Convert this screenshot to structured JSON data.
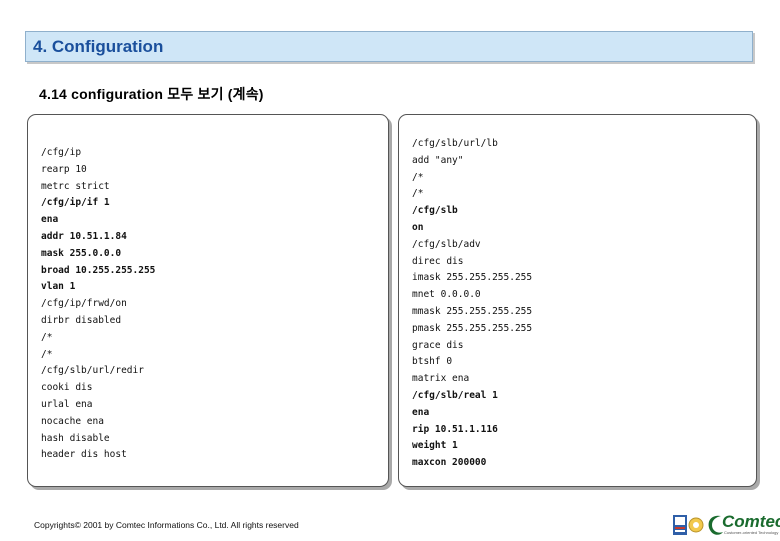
{
  "header": {
    "title": "4. Configuration"
  },
  "subtitle": "4.14 configuration 모두 보기 (계속)",
  "left_panel": {
    "lines": [
      {
        "text": "/cfg/ip",
        "bold": false
      },
      {
        "text": "rearp 10",
        "bold": false
      },
      {
        "text": "metrc strict",
        "bold": false
      },
      {
        "text": "/cfg/ip/if 1",
        "bold": true
      },
      {
        "text": "ena",
        "bold": true
      },
      {
        "text": "addr 10.51.1.84",
        "bold": true
      },
      {
        "text": "mask 255.0.0.0",
        "bold": true
      },
      {
        "text": "broad 10.255.255.255",
        "bold": true
      },
      {
        "text": "vlan 1",
        "bold": true
      },
      {
        "text": "/cfg/ip/frwd/on",
        "bold": false
      },
      {
        "text": "dirbr disabled",
        "bold": false
      },
      {
        "text": "/*",
        "bold": false
      },
      {
        "text": "/*",
        "bold": false
      },
      {
        "text": "/cfg/slb/url/redir",
        "bold": false
      },
      {
        "text": "cooki dis",
        "bold": false
      },
      {
        "text": "urlal ena",
        "bold": false
      },
      {
        "text": "nocache ena",
        "bold": false
      },
      {
        "text": "hash disable",
        "bold": false
      },
      {
        "text": "header dis host",
        "bold": false
      }
    ]
  },
  "right_panel": {
    "lines": [
      {
        "text": "/cfg/slb/url/lb",
        "bold": false
      },
      {
        "text": "add \"any\"",
        "bold": false
      },
      {
        "text": "/*",
        "bold": false
      },
      {
        "text": "/*",
        "bold": false
      },
      {
        "text": "/cfg/slb",
        "bold": true
      },
      {
        "text": "on",
        "bold": true
      },
      {
        "text": "/cfg/slb/adv",
        "bold": false
      },
      {
        "text": "direc dis",
        "bold": false
      },
      {
        "text": "imask 255.255.255.255",
        "bold": false
      },
      {
        "text": "mnet 0.0.0.0",
        "bold": false
      },
      {
        "text": "mmask 255.255.255.255",
        "bold": false
      },
      {
        "text": "pmask 255.255.255.255",
        "bold": false
      },
      {
        "text": "grace dis",
        "bold": false
      },
      {
        "text": "btshf 0",
        "bold": false
      },
      {
        "text": "matrix ena",
        "bold": false
      },
      {
        "text": "/cfg/slb/real 1",
        "bold": true
      },
      {
        "text": "ena",
        "bold": true
      },
      {
        "text": "rip 10.51.1.116",
        "bold": true
      },
      {
        "text": "weight 1",
        "bold": true
      },
      {
        "text": "maxcon 200000",
        "bold": true
      }
    ]
  },
  "footer": {
    "copyright": "Copyrights© 2001 by Comtec Informations Co., Ltd. All rights reserved"
  },
  "logos": {
    "brand": "Comtec",
    "tagline": "Customer-oriented Technology"
  }
}
